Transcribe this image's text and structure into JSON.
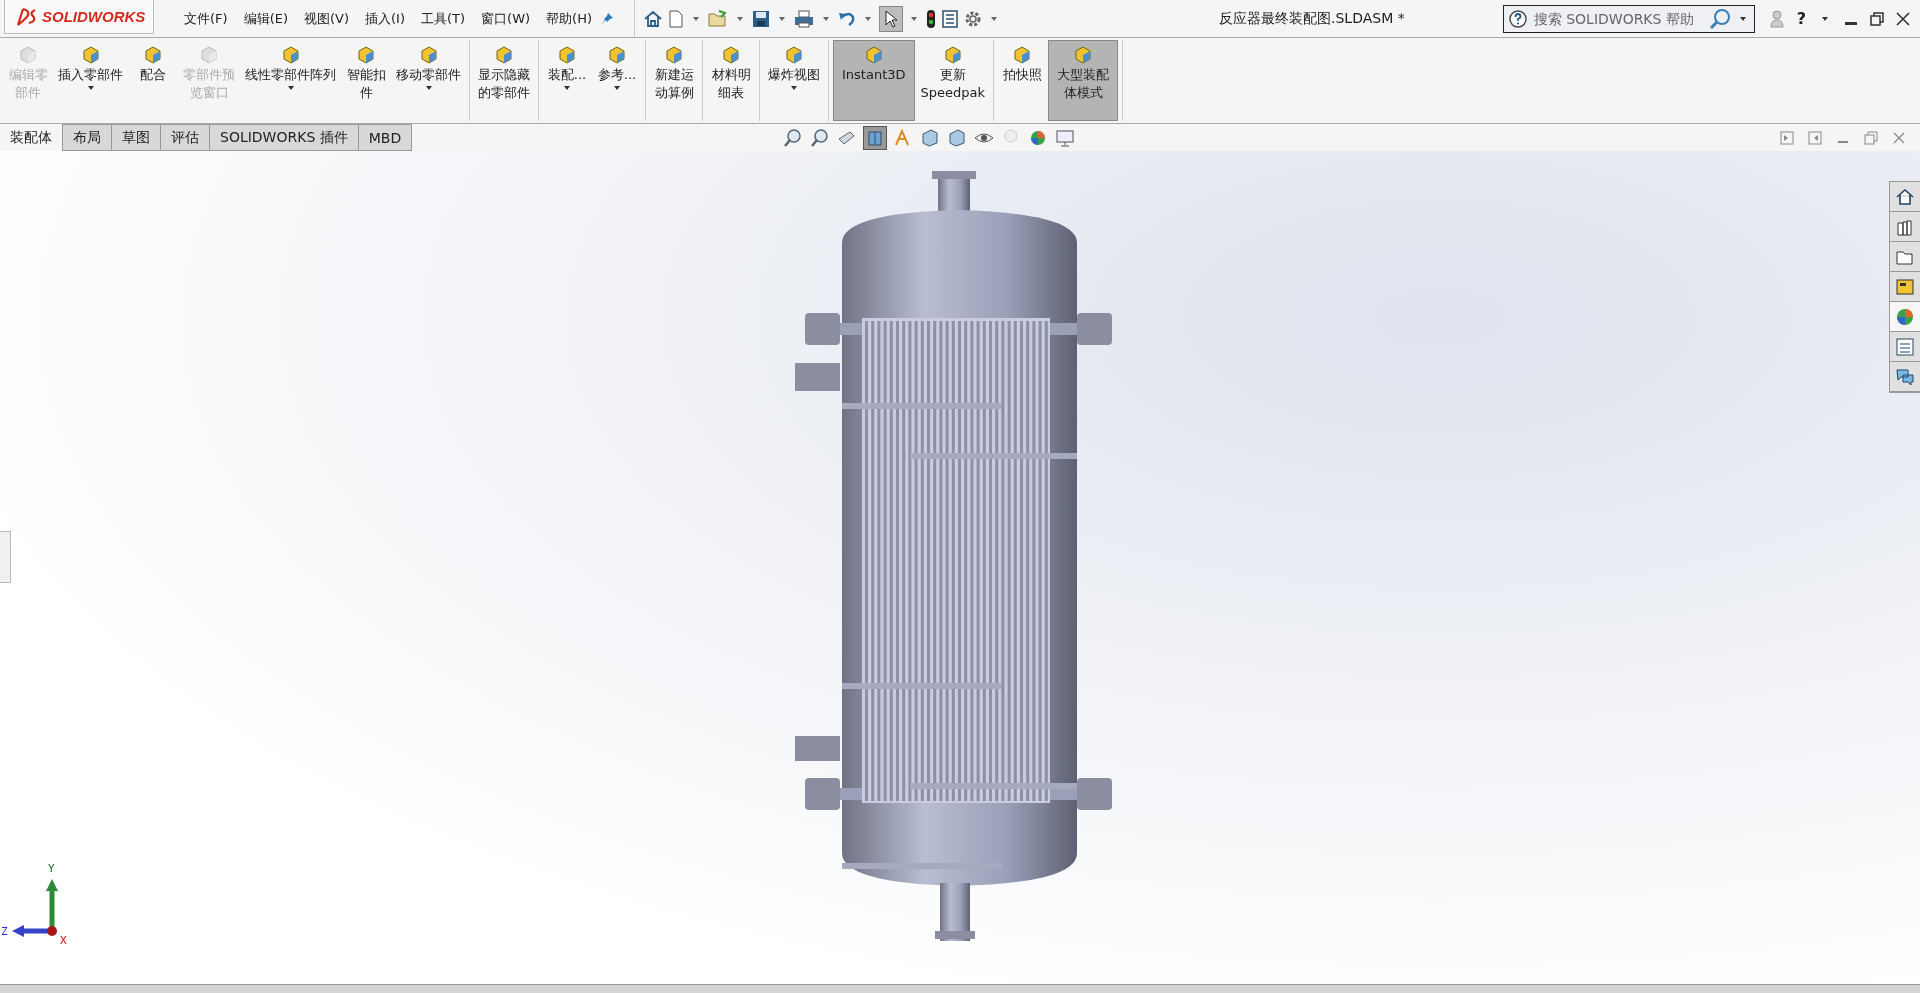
{
  "logo": {
    "text": "SOLIDWORKS"
  },
  "menu": [
    "文件(F)",
    "编辑(E)",
    "视图(V)",
    "插入(I)",
    "工具(T)",
    "窗口(W)",
    "帮助(H)"
  ],
  "title": "反应器最终装配图.SLDASM *",
  "search": {
    "placeholder": "搜索 SOLIDWORKS 帮助"
  },
  "help": {
    "label": "?"
  },
  "ribbon": [
    [
      {
        "lines": [
          "编辑零",
          "部件"
        ],
        "disabled": true,
        "selected": false,
        "dropdown": false
      },
      {
        "lines": [
          "插入零部件"
        ],
        "disabled": false,
        "selected": false,
        "dropdown": true
      },
      {
        "lines": [
          "配合"
        ],
        "disabled": false,
        "selected": false,
        "dropdown": false
      },
      {
        "lines": [
          "零部件预",
          "览窗口"
        ],
        "disabled": true,
        "selected": false,
        "dropdown": false
      },
      {
        "lines": [
          "线性零部件阵列"
        ],
        "disabled": false,
        "selected": false,
        "dropdown": true
      },
      {
        "lines": [
          "智能扣",
          "件"
        ],
        "disabled": false,
        "selected": false,
        "dropdown": false
      },
      {
        "lines": [
          "移动零部件"
        ],
        "disabled": false,
        "selected": false,
        "dropdown": true
      }
    ],
    [
      {
        "lines": [
          "显示隐藏",
          "的零部件"
        ],
        "disabled": false,
        "selected": false,
        "dropdown": false
      }
    ],
    [
      {
        "lines": [
          "装配..."
        ],
        "disabled": false,
        "selected": false,
        "dropdown": true
      },
      {
        "lines": [
          "参考..."
        ],
        "disabled": false,
        "selected": false,
        "dropdown": true
      }
    ],
    [
      {
        "lines": [
          "新建运",
          "动算例"
        ],
        "disabled": false,
        "selected": false,
        "dropdown": false
      }
    ],
    [
      {
        "lines": [
          "材料明",
          "细表"
        ],
        "disabled": false,
        "selected": false,
        "dropdown": false
      }
    ],
    [
      {
        "lines": [
          "爆炸视图"
        ],
        "disabled": false,
        "selected": false,
        "dropdown": true
      }
    ],
    [
      {
        "lines": [
          "Instant3D"
        ],
        "disabled": false,
        "selected": true,
        "dropdown": false
      },
      {
        "lines": [
          "更新",
          "Speedpak"
        ],
        "disabled": false,
        "selected": false,
        "dropdown": false
      }
    ],
    [
      {
        "lines": [
          "拍快照"
        ],
        "disabled": false,
        "selected": false,
        "dropdown": false
      },
      {
        "lines": [
          "大型装配",
          "体模式"
        ],
        "disabled": false,
        "selected": true,
        "dropdown": false
      }
    ]
  ],
  "tabs": [
    {
      "label": "装配体",
      "selected": true
    },
    {
      "label": "布局",
      "selected": false
    },
    {
      "label": "草图",
      "selected": false
    },
    {
      "label": "评估",
      "selected": false
    },
    {
      "label": "SOLIDWORKS 插件",
      "selected": false
    },
    {
      "label": "MBD",
      "selected": false
    }
  ],
  "task_pane": [
    {
      "selected": false
    },
    {
      "selected": false
    },
    {
      "selected": false
    },
    {
      "selected": false
    },
    {
      "selected": true
    },
    {
      "selected": false
    },
    {
      "selected": false
    }
  ],
  "triad": {
    "x": "X",
    "y": "Y",
    "z": "Z"
  }
}
